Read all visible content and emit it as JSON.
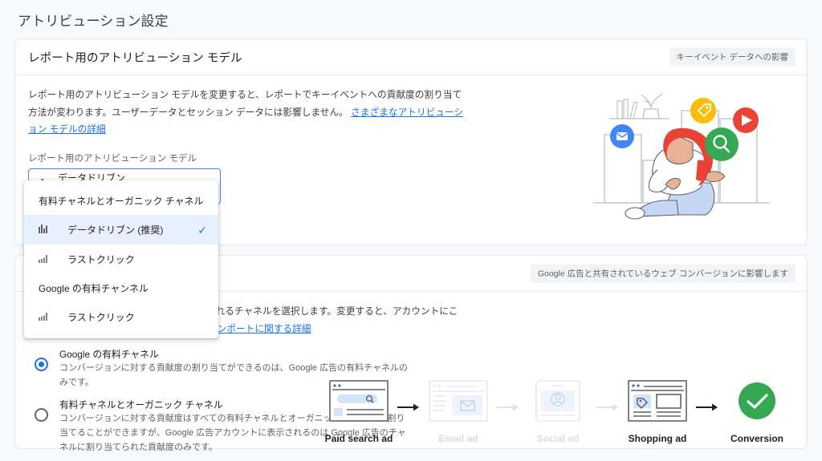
{
  "page": {
    "title": "アトリビューション設定",
    "background": "#f8f9fa",
    "accent": "#1a73e8"
  },
  "report_card": {
    "title": "レポート用のアトリビューション モデル",
    "chip": "キーイベント データへの影響",
    "description_1": "レポート用のアトリビューション モデルを変更すると、レポートでキーイベントへの貢献度の割り当て方法が変わります。ユーザーデータとセッション データには影響しません。 ",
    "description_link": "さまざまなアトリビューション モデルの詳細",
    "field_label": "レポート用のアトリビューション モデル",
    "select": {
      "icon": "bar-chart-icon",
      "value": "データドリブン",
      "subtitle": "有料チャネルとオーガニック チャネル",
      "caret": "chevron-down-icon"
    },
    "menu": {
      "groups": [
        {
          "label": "有料チャネルとオーガニック チャネル",
          "items": [
            {
              "label": "データドリブン (推奨)",
              "icon": "bar-chart-icon",
              "selected": true
            },
            {
              "label": "ラストクリック",
              "icon": "bar-chart-icon",
              "selected": false
            }
          ]
        },
        {
          "label": "Google の有料チャンネル",
          "items": [
            {
              "label": "ラストクリック",
              "icon": "bar-chart-icon",
              "selected": false
            }
          ]
        }
      ]
    }
  },
  "ads_card": {
    "chip": "Google 広告と共有されているウェブ コンバージョンに影響します",
    "description_1": "コンバージョンに対する貢献度が割り当てられるチャネルを選択します。変更すると、アカウントにこの設定が適用されます。 ",
    "description_link": "コンバージョンのインポートに関する詳細",
    "options": [
      {
        "title": "Google の有料チャネル",
        "description": "コンバージョンに対する貢献度の割り当てができるのは、Google 広告の有料チャネルのみです。",
        "selected": true
      },
      {
        "title": "有料チャネルとオーガニック チャネル",
        "description": "コンバージョンに対する貢献度はすべての有料チャネルとオーガニック チャネルに割り当てることができますが、Google 広告アカウントに表示されるのは Google 広告のチャネルに割り当てられた貢献度のみです。",
        "selected": false
      }
    ],
    "funnel": {
      "steps": [
        {
          "label": "Paid search ad",
          "icon": "search-ad-icon",
          "dim": false
        },
        {
          "label": "Email ad",
          "icon": "email-ad-icon",
          "dim": true
        },
        {
          "label": "Social ad",
          "icon": "social-ad-icon",
          "dim": true
        },
        {
          "label": "Shopping ad",
          "icon": "shopping-ad-icon",
          "dim": false
        },
        {
          "label": "Conversion",
          "icon": "conversion-check-icon",
          "dim": false
        }
      ],
      "conversion_color": "#34a853"
    }
  }
}
